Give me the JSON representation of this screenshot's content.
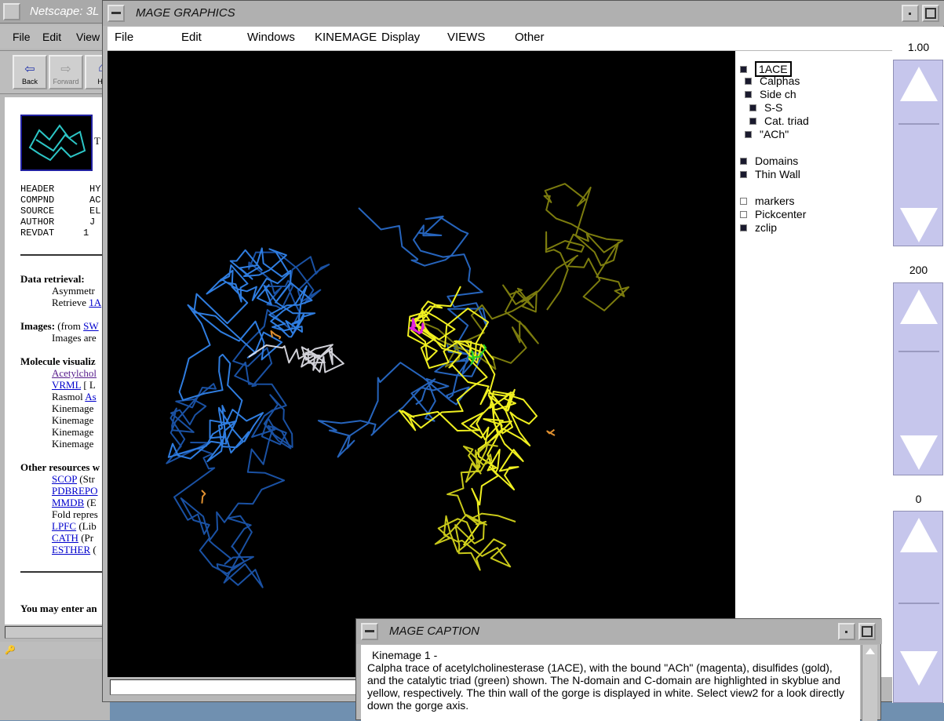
{
  "netscape": {
    "title": "Netscape: 3L",
    "menu": [
      "File",
      "Edit",
      "View"
    ],
    "toolbar": {
      "back": "Back",
      "forward": "Forward",
      "home": "Ho"
    },
    "header_rows": [
      {
        "key": "HEADER",
        "val": "HY"
      },
      {
        "key": "COMPND",
        "val": "AC"
      },
      {
        "key": "SOURCE",
        "val": "EL"
      },
      {
        "key": "AUTHOR",
        "val": "J"
      },
      {
        "key": "REVDAT",
        "val": "1"
      }
    ],
    "thumb_letter": "T",
    "data_retrieval": "Data retrieval:",
    "asym": "Asymmetr",
    "retrieve": "Retrieve",
    "retrieve_link": "1A",
    "images": "Images:",
    "images_from": "(from",
    "images_link": "SW",
    "images_are": "Images are",
    "mol_vis": "Molecule visualiz",
    "acetyl_link": "Acetylchol",
    "vrml_link": "VRML",
    "vrml_rest": "[ L",
    "rasmol": "Rasmol",
    "rasmol_link": "As",
    "kinemage_rows": [
      "Kinemage",
      "Kinemage",
      "Kinemage",
      "Kinemage"
    ],
    "other_res": "Other resources w",
    "res_links": [
      {
        "link": "SCOP",
        "rest": "(Str"
      },
      {
        "link": "PDBREPO",
        "rest": ""
      },
      {
        "link": "MMDB",
        "rest": "(E"
      }
    ],
    "fold": "Fold repres",
    "res_links2": [
      {
        "link": "LPFC",
        "rest": "(Lib"
      },
      {
        "link": "CATH",
        "rest": "(Pr"
      },
      {
        "link": "ESTHER",
        "rest": "("
      }
    ],
    "you_may": "You may enter an"
  },
  "mage": {
    "title": "MAGE GRAPHICS",
    "menu": [
      "File",
      "Edit",
      "Windows",
      "KINEMAGE",
      "Display",
      "VIEWS",
      "Other"
    ],
    "kinemage_list": [
      {
        "label": "1ACE",
        "on": true,
        "selected": true
      },
      {
        "label": "Calphas",
        "on": true
      },
      {
        "label": "Side ch",
        "on": true
      },
      {
        "label": "S-S",
        "on": true
      },
      {
        "label": "Cat. triad",
        "on": true
      },
      {
        "label": "\"ACh\"",
        "on": true
      },
      {
        "label": "Domains",
        "on": true
      },
      {
        "label": "Thin Wall",
        "on": true
      },
      {
        "label": "markers",
        "on": false
      },
      {
        "label": "Pickcenter",
        "on": false
      },
      {
        "label": "zclip",
        "on": true
      }
    ],
    "sliders": [
      {
        "value": "1.00"
      },
      {
        "value": "200"
      },
      {
        "value": "0"
      }
    ],
    "colors": {
      "nterm": "#2f7de0",
      "cterm": "#f0f020",
      "wall": "#e8e8f0",
      "ach": "#e020e0",
      "ss": "#e09030",
      "triad": "#20d020"
    }
  },
  "caption": {
    "title": "MAGE CAPTION",
    "heading": "Kinemage  1 -",
    "text": "Calpha trace of acetylcholinesterase (1ACE), with the bound \"ACh\" (magenta), disulfides (gold), and the catalytic triad (green) shown.  The N-domain and C-domain are highlighted in skyblue and yellow, respectively.  The thin wall of the gorge is displayed in white.  Select view2 for a look directly down the gorge axis."
  }
}
